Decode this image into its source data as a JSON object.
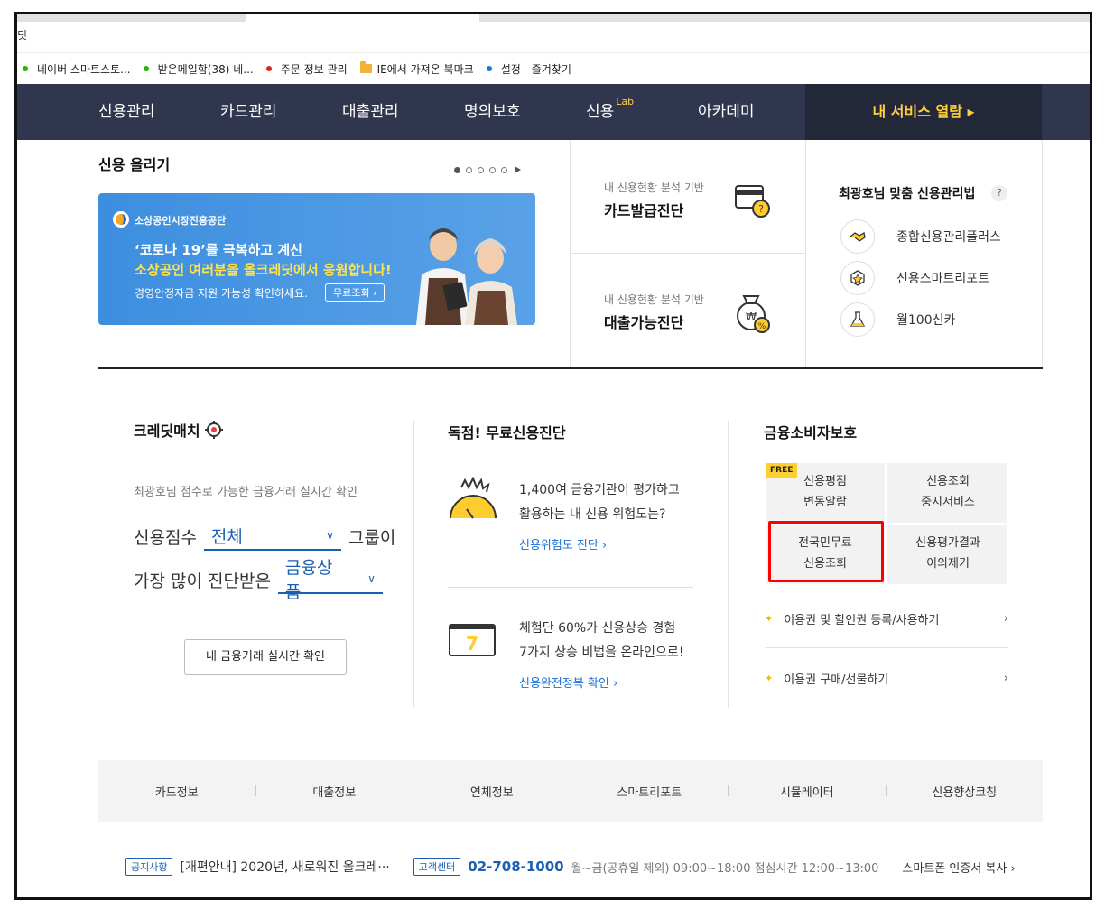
{
  "browser": {
    "tab_title": "딧",
    "bookmarks": [
      {
        "label": "네이버 스마트스토...",
        "color": "#2db400",
        "kind": "dot"
      },
      {
        "label": "받은메일함(38)  네...",
        "color": "#2db400",
        "kind": "dot"
      },
      {
        "label": "주문 정보 관리",
        "color": "#e02020",
        "kind": "dot"
      },
      {
        "label": "IE에서 가져온 북마크",
        "color": "#f2b233",
        "kind": "folder"
      },
      {
        "label": "설정 - 즐겨찾기",
        "color": "#1a73e8",
        "kind": "dot"
      }
    ]
  },
  "nav": {
    "items": [
      "신용관리",
      "카드관리",
      "대출관리",
      "명의보호",
      "신용",
      "아카데미"
    ],
    "lab_sup": "Lab",
    "my_service": "내 서비스 열람 ▸"
  },
  "hero": {
    "title": "신용 올리기",
    "banner": {
      "org": "소상공인시장진흥공단",
      "line1": "‘코로나 19’를 극복하고 계신",
      "line2": "소상공인 여러분을 올크레딧에서 응원합니다!",
      "line3": "경영안정자금 지원 가능성 확인하세요.",
      "button": "무료조회 ›"
    }
  },
  "diagnosis": [
    {
      "sub": "내 신용현황 분석 기반",
      "title": "카드발급진단",
      "icon": "card-question-icon"
    },
    {
      "sub": "내 신용현황 분석 기반",
      "title": "대출가능진단",
      "icon": "money-bag-icon"
    }
  ],
  "service_panel": {
    "title": "최광호님 맞춤 신용관리법",
    "help": "?",
    "items": [
      {
        "label": "종합신용관리플러스",
        "icon": "handshake-icon"
      },
      {
        "label": "신용스마트리포트",
        "icon": "star-badge-icon"
      },
      {
        "label": "월100신카",
        "icon": "lab-flask-icon"
      }
    ]
  },
  "credit_match": {
    "title": "크레딧매치",
    "desc": "최광호님 점수로 가능한 금융거래 실시간 확인",
    "row1_prefix": "신용점수",
    "row1_select": "전체",
    "row1_suffix": "그룹이",
    "row2_prefix": "가장 많이 진단받은",
    "row2_select": "금융상품",
    "button": "내 금융거래 실시간 확인"
  },
  "free_diag": {
    "title": "독점! 무료신용진단",
    "block1": {
      "line1": "1,400여 금융기관이 평가하고",
      "line2": "활용하는 내 신용 위험도는?",
      "link": "신용위험도 진단  ›"
    },
    "block2": {
      "line1": "체험단 60%가 신용상승 경험",
      "line2": "7가지 상승 비법을 온라인으로!",
      "link": "신용완전정복 확인  ›",
      "badge": "7"
    }
  },
  "consumer": {
    "title": "금융소비자보호",
    "free": "FREE",
    "cells": [
      {
        "l1": "신용평점",
        "l2": "변동알람"
      },
      {
        "l1": "신용조회",
        "l2": "중지서비스"
      },
      {
        "l1": "전국민무료",
        "l2": "신용조회"
      },
      {
        "l1": "신용평가결과",
        "l2": "이의제기"
      }
    ],
    "links": [
      {
        "label": "이용권 및 할인권 등록/사용하기",
        "arrow": "›"
      },
      {
        "label": "이용권 구매/선물하기",
        "arrow": "›"
      }
    ],
    "highlight_color": "#ff0000"
  },
  "bottom_tabs": [
    "카드정보",
    "대출정보",
    "연체정보",
    "스마트리포트",
    "시뮬레이터",
    "신용향상코칭"
  ],
  "footer": {
    "notice_tag": "공지사항",
    "notice": "[개편안내] 2020년, 새로워진 올크레···",
    "center_tag": "고객센터",
    "phone": "02-708-1000",
    "hours": "월~금(공휴일 제외) 09:00~18:00 점심시간 12:00~13:00",
    "cert": "스마트폰 인증서 복사  ›"
  }
}
